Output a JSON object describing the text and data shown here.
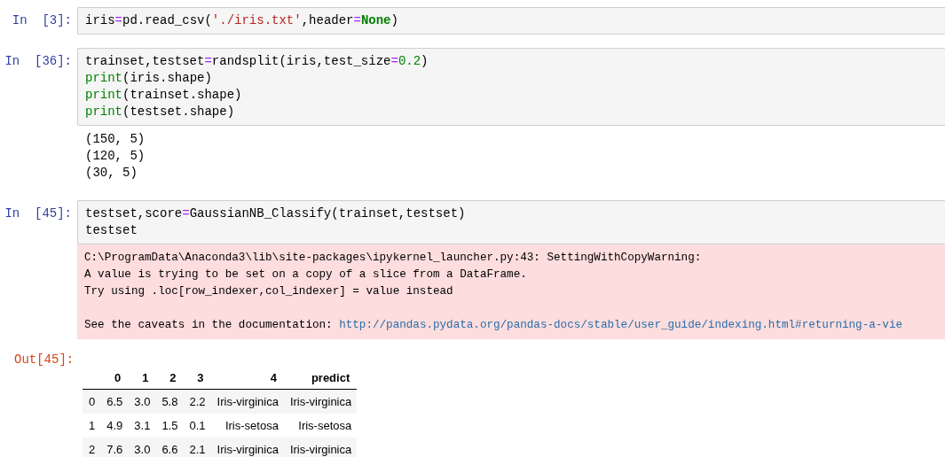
{
  "cells": [
    {
      "prompt": "In  [3]:",
      "code": [
        [
          {
            "kind": "plain",
            "t": "iris"
          },
          {
            "kind": "op",
            "t": "="
          },
          {
            "kind": "plain",
            "t": "pd.read_csv("
          },
          {
            "kind": "str",
            "t": "'./iris.txt'"
          },
          {
            "kind": "plain",
            "t": ",header"
          },
          {
            "kind": "op",
            "t": "="
          },
          {
            "kind": "kw",
            "t": "None"
          },
          {
            "kind": "plain",
            "t": ")"
          }
        ]
      ]
    },
    {
      "prompt": "In  [36]:",
      "code": [
        [
          {
            "kind": "plain",
            "t": "trainset,testset"
          },
          {
            "kind": "op",
            "t": "="
          },
          {
            "kind": "plain",
            "t": "randsplit(iris,test_size"
          },
          {
            "kind": "op",
            "t": "="
          },
          {
            "kind": "num",
            "t": "0.2"
          },
          {
            "kind": "plain",
            "t": ")"
          }
        ],
        [
          {
            "kind": "builtin",
            "t": "print"
          },
          {
            "kind": "plain",
            "t": "(iris.shape)"
          }
        ],
        [
          {
            "kind": "builtin",
            "t": "print"
          },
          {
            "kind": "plain",
            "t": "(trainset.shape)"
          }
        ],
        [
          {
            "kind": "builtin",
            "t": "print"
          },
          {
            "kind": "plain",
            "t": "(testset.shape)"
          }
        ]
      ],
      "outputs": [
        {
          "kind": "stream",
          "lines": [
            "(150, 5)",
            "(120, 5)",
            "(30, 5)"
          ]
        }
      ]
    },
    {
      "prompt": "In  [45]:",
      "code": [
        [
          {
            "kind": "plain",
            "t": "testset,score"
          },
          {
            "kind": "op",
            "t": "="
          },
          {
            "kind": "plain",
            "t": "GaussianNB_Classify(trainset,testset)"
          }
        ],
        [
          {
            "kind": "plain",
            "t": "testset"
          }
        ]
      ],
      "outputs": [
        {
          "kind": "stderr",
          "paragraphs": [
            {
              "lines": [
                "C:\\ProgramData\\Anaconda3\\lib\\site-packages\\ipykernel_launcher.py:43: SettingWithCopyWarning:",
                "A value is trying to be set on a copy of a slice from a DataFrame.",
                "Try using .loc[row_indexer,col_indexer] = value instead"
              ]
            },
            {
              "lines": [
                "See the caveats in the documentation:"
              ],
              "link": "http://pandas.pydata.org/pandas-docs/stable/user_guide/indexing.html#returning-a-vie"
            }
          ]
        },
        {
          "kind": "table",
          "prompt": "Out[45]:",
          "columns": [
            "",
            "0",
            "1",
            "2",
            "3",
            "4",
            "predict"
          ],
          "rows": [
            [
              "0",
              "6.5",
              "3.0",
              "5.8",
              "2.2",
              "Iris-virginica",
              "Iris-virginica"
            ],
            [
              "1",
              "4.9",
              "3.1",
              "1.5",
              "0.1",
              "Iris-setosa",
              "Iris-setosa"
            ],
            [
              "2",
              "7.6",
              "3.0",
              "6.6",
              "2.1",
              "Iris-virginica",
              "Iris-virginica"
            ]
          ]
        }
      ]
    }
  ]
}
